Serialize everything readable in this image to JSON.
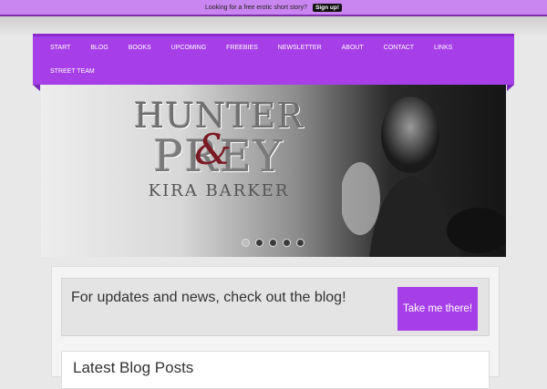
{
  "topbar": {
    "message": "Looking for a free erotic short story?",
    "cta": "Sign up!"
  },
  "nav": {
    "items": [
      "START",
      "BLOG",
      "BOOKS",
      "UPCOMING",
      "FREEBIES",
      "NEWSLETTER",
      "ABOUT",
      "CONTACT",
      "LINKS",
      "STREET TEAM"
    ]
  },
  "hero": {
    "title_line1": "HUNTER",
    "ampersand": "&",
    "title_line2": "PREY",
    "author": "KIRA BARKER",
    "slide_count": 5,
    "active_slide": 1
  },
  "notice": {
    "message": "For updates and news, check out the blog!",
    "button": "Take me there!"
  },
  "latest": {
    "heading": "Latest Blog Posts"
  },
  "colors": {
    "accent": "#a63fe8",
    "topbar": "#c986f0"
  }
}
